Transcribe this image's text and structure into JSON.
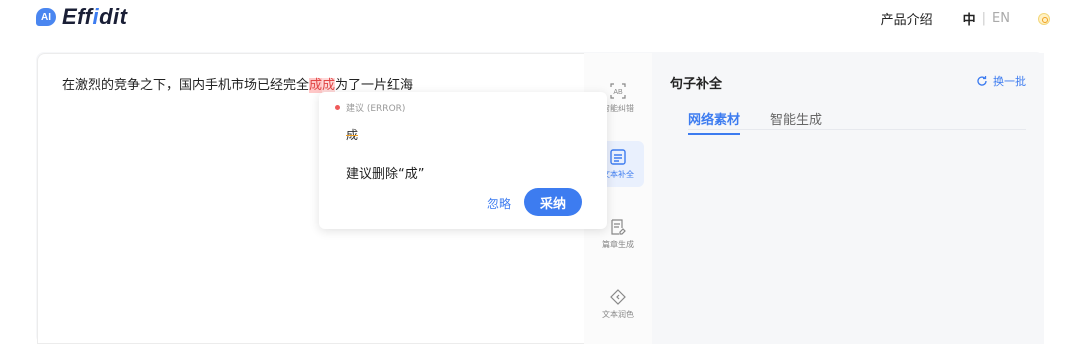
{
  "header": {
    "logo_badge": "AI",
    "logo_left": "Eff",
    "logo_i": "i",
    "logo_right": "dit",
    "nav_intro": "产品介绍",
    "lang_cn": "中",
    "lang_sep": "|",
    "lang_en": "EN"
  },
  "editor": {
    "text_before": "在激烈的竞争之下，国内手机市场已经完全",
    "highlight_1": "成",
    "highlight_2": "成",
    "text_after": "为了一片红海"
  },
  "popup": {
    "type_label": "建议 (ERROR)",
    "word": "成",
    "message": "建议删除“成”",
    "ignore_label": "忽略",
    "accept_label": "采纳"
  },
  "tools": [
    {
      "label": "智能纠错",
      "icon": "ab-check-icon"
    },
    {
      "label": "文本补全",
      "icon": "document-complete-icon"
    },
    {
      "label": "篇章生成",
      "icon": "article-generate-icon"
    },
    {
      "label": "文本润色",
      "icon": "polish-icon"
    }
  ],
  "panel": {
    "title": "句子补全",
    "refresh_label": "换一批",
    "tabs": [
      {
        "label": "网络素材"
      },
      {
        "label": "智能生成"
      }
    ]
  },
  "colors": {
    "accent": "#3d7cf0",
    "error": "#e04545"
  }
}
